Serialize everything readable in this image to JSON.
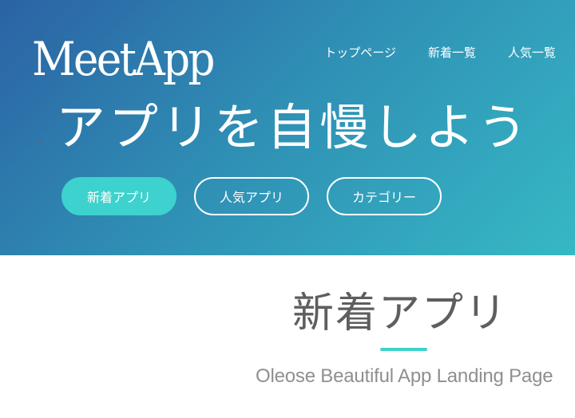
{
  "header": {
    "logo_text": "MeetApp",
    "nav": [
      {
        "label": "トップページ"
      },
      {
        "label": "新着一覧"
      },
      {
        "label": "人気一覧"
      }
    ]
  },
  "hero": {
    "tagline": "アプリを自慢しよう",
    "buttons": [
      {
        "label": "新着アプリ"
      },
      {
        "label": "人気アプリ"
      },
      {
        "label": "カテゴリー"
      }
    ]
  },
  "section": {
    "title": "新着アプリ",
    "subtitle": "Oleose Beautiful App Landing Page"
  },
  "colors": {
    "accent": "#3dd2cd",
    "hero_gradient_start": "#2b62a4",
    "hero_gradient_end": "#36b8c5"
  }
}
